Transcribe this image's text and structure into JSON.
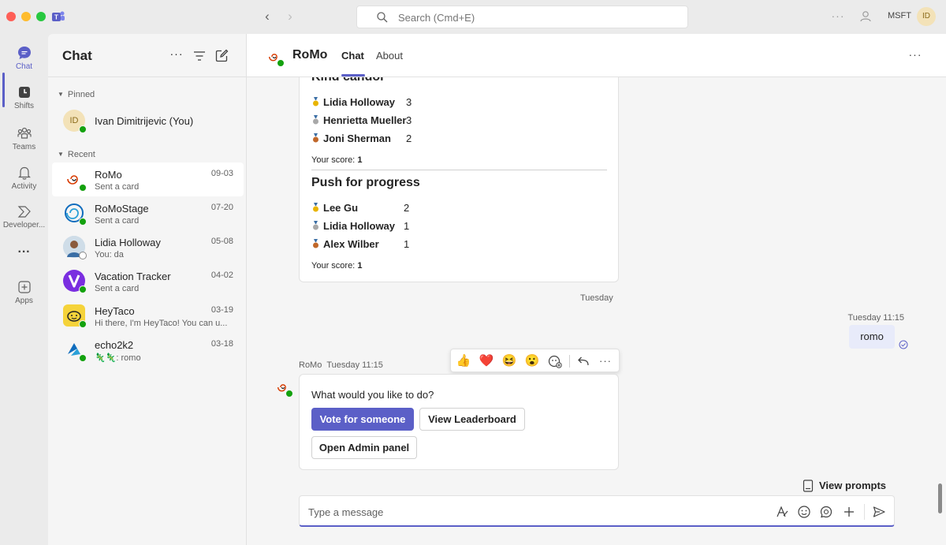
{
  "search": {
    "placeholder": "Search (Cmd+E)"
  },
  "titlebar": {
    "org": "MSFT",
    "avatar_initials": "ID"
  },
  "rail": {
    "items": [
      {
        "label": "Chat",
        "icon": "chat-icon"
      },
      {
        "label": "Shifts",
        "icon": "shifts-icon"
      },
      {
        "label": "Teams",
        "icon": "teams-icon"
      },
      {
        "label": "Activity",
        "icon": "bell-icon"
      },
      {
        "label": "Developer...",
        "icon": "developer-icon"
      },
      {
        "label": "Apps",
        "icon": "apps-icon"
      }
    ],
    "more": "···"
  },
  "chatlist": {
    "title": "Chat",
    "pinned_label": "Pinned",
    "recent_label": "Recent",
    "pinned": [
      {
        "name": "Ivan Dimitrijevic (You)",
        "initials": "ID"
      }
    ],
    "recent": [
      {
        "name": "RoMo",
        "date": "09-03",
        "preview": "Sent a card"
      },
      {
        "name": "RoMoStage",
        "date": "07-20",
        "preview": "Sent a card"
      },
      {
        "name": "Lidia Holloway",
        "date": "05-08",
        "preview": "You: da"
      },
      {
        "name": "Vacation Tracker",
        "date": "04-02",
        "preview": "Sent a card"
      },
      {
        "name": "HeyTaco",
        "date": "03-19",
        "preview": "Hi there, I'm HeyTaco! You can u..."
      },
      {
        "name": "echo2k2",
        "date": "03-18",
        "preview": "🦎🦎: romo"
      }
    ]
  },
  "main": {
    "title": "RoMo",
    "tabs": [
      {
        "label": "Chat"
      },
      {
        "label": "About"
      }
    ],
    "more": "···"
  },
  "leaderboard": {
    "kind_candor": {
      "title": "Kind candor",
      "rows": [
        {
          "name": "Lidia Holloway",
          "score": "3",
          "medal": "gold"
        },
        {
          "name": "Henrietta Mueller",
          "score": "3",
          "medal": "silver"
        },
        {
          "name": "Joni Sherman",
          "score": "2",
          "medal": "bronze"
        }
      ],
      "your_score_label": "Your score:",
      "your_score": "1"
    },
    "push_for_progress": {
      "title": "Push for progress",
      "rows": [
        {
          "name": "Lee Gu",
          "score": "2",
          "medal": "gold"
        },
        {
          "name": "Lidia Holloway",
          "score": "1",
          "medal": "silver"
        },
        {
          "name": "Alex Wilber",
          "score": "1",
          "medal": "bronze"
        }
      ],
      "your_score_label": "Your score:",
      "your_score": "1"
    }
  },
  "conversation": {
    "date_divider": "Tuesday",
    "my_message": {
      "meta": "Tuesday 11:15",
      "text": "romo"
    },
    "bot_message": {
      "sender": "RoMo",
      "time": "Tuesday 11:15",
      "text": "What would you like to do?",
      "buttons": {
        "vote": "Vote for someone",
        "leaderboard": "View Leaderboard",
        "admin": "Open Admin panel"
      }
    },
    "reactions": [
      "👍",
      "❤️",
      "😆",
      "😮"
    ]
  },
  "view_prompts": "View prompts",
  "composer": {
    "placeholder": "Type a message"
  },
  "colors": {
    "accent": "#5b5fc7",
    "presence": "#13a10e",
    "bubble": "#e8ebfa"
  }
}
